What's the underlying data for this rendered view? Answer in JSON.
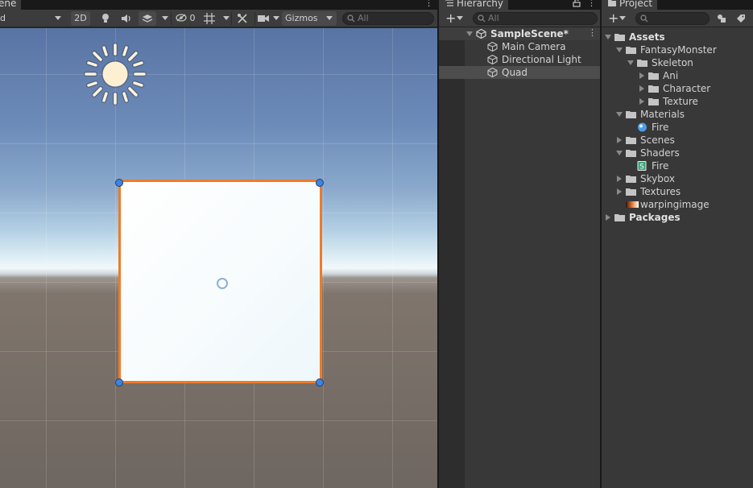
{
  "scene": {
    "tab_label": "ene",
    "shading_mode": "d",
    "btn_2d": "2D",
    "hidden_count": "0",
    "gizmos_label": "Gizmos",
    "search_placeholder": "All"
  },
  "hierarchy": {
    "tab_label": "Hierarchy",
    "search_placeholder": "All",
    "scene_name": "SampleScene*",
    "objects": [
      {
        "label": "Main Camera",
        "icon": "gameobject-icon",
        "selected": false
      },
      {
        "label": "Directional Light",
        "icon": "gameobject-icon",
        "selected": false
      },
      {
        "label": "Quad",
        "icon": "gameobject-icon",
        "selected": true
      }
    ]
  },
  "project": {
    "tab_label": "Project",
    "search_placeholder": "",
    "tree": [
      {
        "label": "Assets",
        "type": "folder",
        "state": "open",
        "bold": true
      },
      {
        "label": "FantasyMonster",
        "type": "folder",
        "state": "open"
      },
      {
        "label": "Skeleton",
        "type": "folder",
        "state": "open"
      },
      {
        "label": "Ani",
        "type": "folder",
        "state": "closed"
      },
      {
        "label": "Character",
        "type": "folder",
        "state": "closed"
      },
      {
        "label": "Texture",
        "type": "folder",
        "state": "closed"
      },
      {
        "label": "Materials",
        "type": "folder",
        "state": "open"
      },
      {
        "label": "Fire",
        "type": "material",
        "state": "none"
      },
      {
        "label": "Scenes",
        "type": "folder",
        "state": "closed"
      },
      {
        "label": "Shaders",
        "type": "folder",
        "state": "open"
      },
      {
        "label": "Fire",
        "type": "shader",
        "state": "none"
      },
      {
        "label": "Skybox",
        "type": "folder",
        "state": "closed"
      },
      {
        "label": "Textures",
        "type": "folder",
        "state": "closed"
      },
      {
        "label": "warpingimage",
        "type": "texture",
        "state": "none"
      },
      {
        "label": "Packages",
        "type": "folder",
        "state": "closed",
        "bold": true
      }
    ]
  },
  "colors": {
    "selection_outline": "#f07a28",
    "handle": "#3d84e4",
    "panel_bg": "#383838",
    "toolbar_bg": "#3c3c3c"
  }
}
